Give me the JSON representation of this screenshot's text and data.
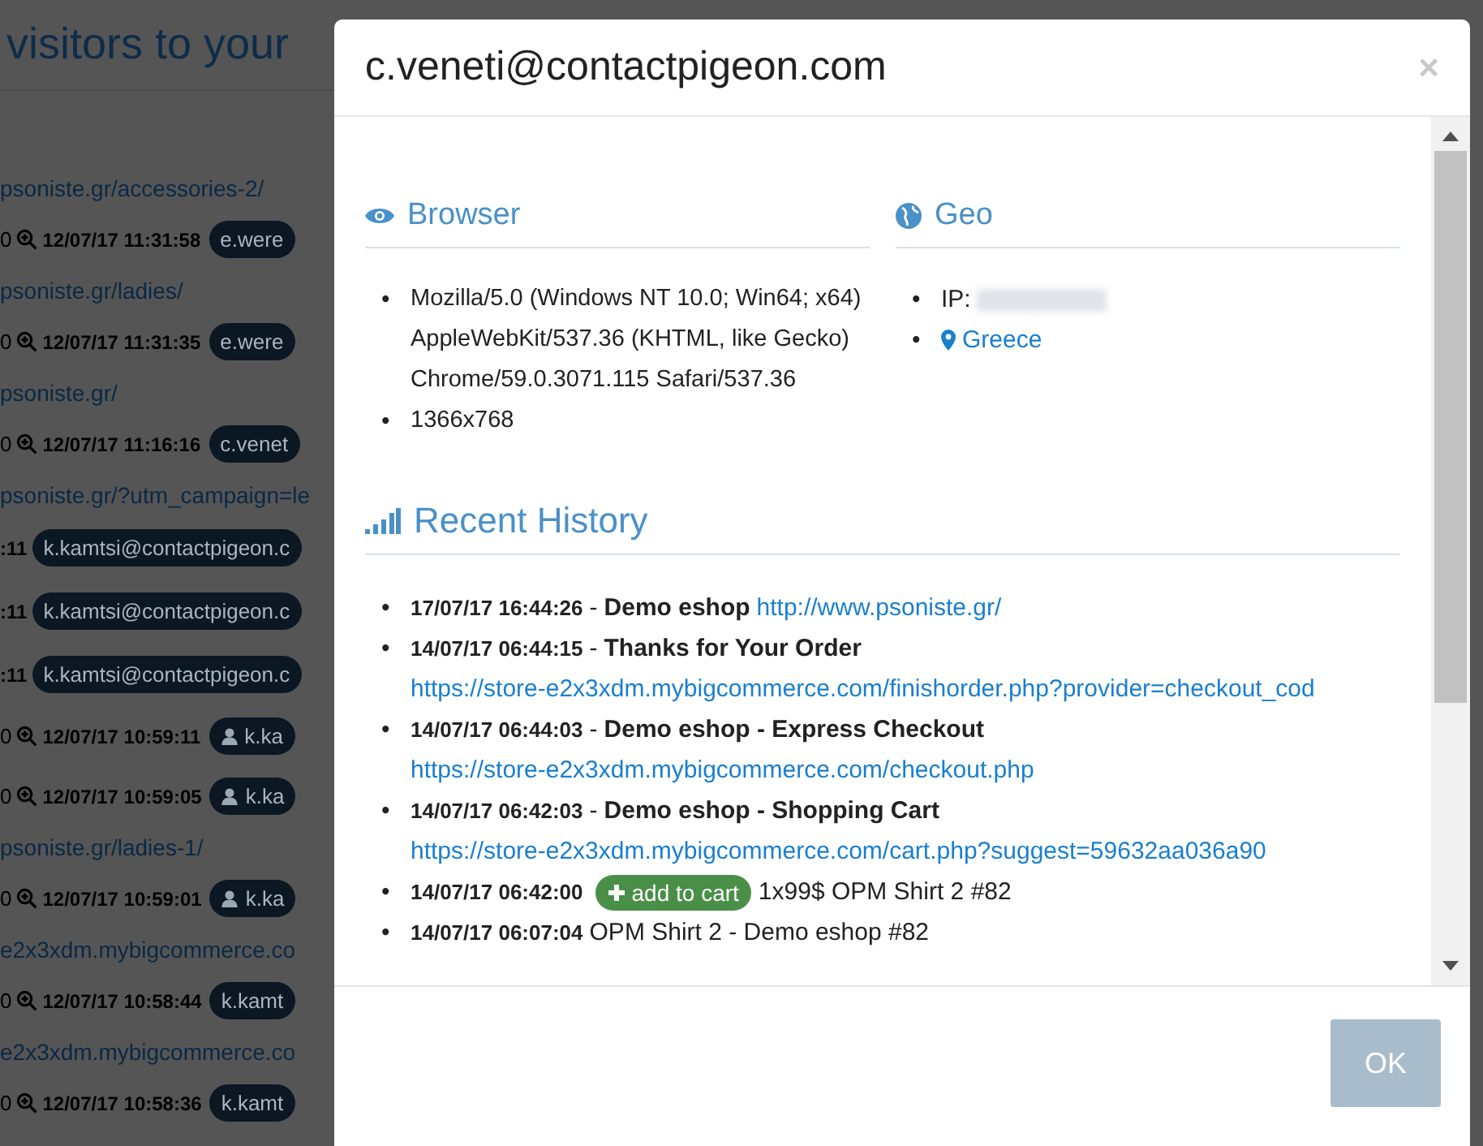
{
  "background": {
    "heading": "visitors to your",
    "rows": [
      {
        "kind": "link",
        "text": "psoniste.gr/accessories-2/"
      },
      {
        "kind": "visit",
        "prefix": "0",
        "time": "12/07/17 11:31:58",
        "user_icon": false,
        "badge": "e.were"
      },
      {
        "kind": "link",
        "text": "psoniste.gr/ladies/"
      },
      {
        "kind": "visit",
        "prefix": "0",
        "time": "12/07/17 11:31:35",
        "user_icon": false,
        "badge": "e.were"
      },
      {
        "kind": "link",
        "text": "psoniste.gr/"
      },
      {
        "kind": "visit",
        "prefix": "0",
        "time": "12/07/17 11:16:16",
        "user_icon": false,
        "badge": "c.venet"
      },
      {
        "kind": "link",
        "text": "psoniste.gr/?utm_campaign=le"
      },
      {
        "kind": "event",
        "prefix": ":11",
        "badge": "k.kamtsi@contactpigeon.c"
      },
      {
        "kind": "event",
        "prefix": ":11",
        "badge": "k.kamtsi@contactpigeon.c"
      },
      {
        "kind": "event",
        "prefix": ":11",
        "badge": "k.kamtsi@contactpigeon.c"
      },
      {
        "kind": "visit",
        "prefix": "0",
        "time": "12/07/17 10:59:11",
        "user_icon": true,
        "badge": "k.ka"
      },
      {
        "kind": "visit",
        "prefix": "0",
        "time": "12/07/17 10:59:05",
        "user_icon": true,
        "badge": "k.ka"
      },
      {
        "kind": "link",
        "text": "psoniste.gr/ladies-1/"
      },
      {
        "kind": "visit",
        "prefix": "0",
        "time": "12/07/17 10:59:01",
        "user_icon": true,
        "badge": "k.ka"
      },
      {
        "kind": "link",
        "text": "e2x3xdm.mybigcommerce.co"
      },
      {
        "kind": "visit",
        "prefix": "0",
        "time": "12/07/17 10:58:44",
        "user_icon": false,
        "badge": "k.kamt"
      },
      {
        "kind": "link",
        "text": "e2x3xdm.mybigcommerce.co"
      },
      {
        "kind": "visit",
        "prefix": "0",
        "time": "12/07/17 10:58:36",
        "user_icon": false,
        "badge": "k.kamt"
      }
    ]
  },
  "modal": {
    "title": "c.veneti@contactpigeon.com",
    "close": "×",
    "bullet": "•",
    "browser": {
      "heading": "Browser",
      "items": [
        "Mozilla/5.0 (Windows NT 10.0; Win64; x64) AppleWebKit/537.36 (KHTML, like Gecko) Chrome/59.0.3071.115 Safari/537.36",
        "1366x768"
      ]
    },
    "geo": {
      "heading": "Geo",
      "ip_label": "IP:",
      "country": "Greece"
    },
    "history": {
      "heading": "Recent History",
      "items": [
        {
          "kind": "page",
          "time": "17/07/17 16:44:26",
          "sep": "-",
          "title": "Demo eshop",
          "url": "http://www.psoniste.gr/"
        },
        {
          "kind": "page",
          "time": "14/07/17 06:44:15",
          "sep": "-",
          "title": "Thanks for Your Order",
          "url": "https://store-e2x3xdm.mybigcommerce.com/finishorder.php?provider=checkout_cod"
        },
        {
          "kind": "page",
          "time": "14/07/17 06:44:03",
          "sep": "-",
          "title": "Demo eshop - Express Checkout",
          "url": "https://store-e2x3xdm.mybigcommerce.com/checkout.php"
        },
        {
          "kind": "page",
          "time": "14/07/17 06:42:03",
          "sep": "-",
          "title": "Demo eshop - Shopping Cart",
          "url": "https://store-e2x3xdm.mybigcommerce.com/cart.php?suggest=59632aa036a90"
        },
        {
          "kind": "event",
          "time": "14/07/17 06:42:00",
          "badge": "add to cart",
          "text": "1x99$ OPM Shirt 2 #82"
        },
        {
          "kind": "plain",
          "time": "14/07/17 06:07:04",
          "text": "OPM Shirt 2 - Demo eshop #82"
        }
      ]
    },
    "ok": "OK"
  }
}
